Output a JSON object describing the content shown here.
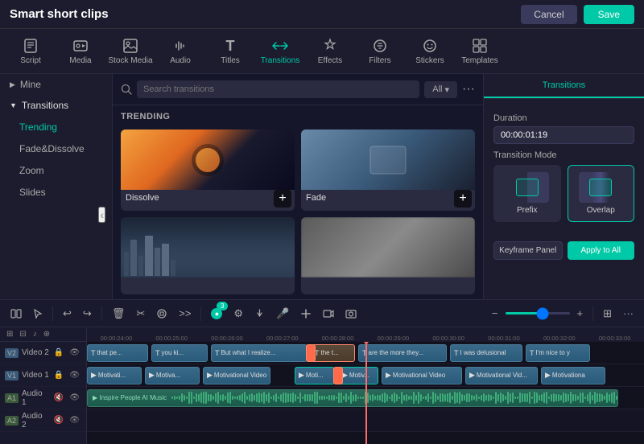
{
  "app": {
    "title": "Smart short clips",
    "cancel_label": "Cancel",
    "save_label": "Save"
  },
  "toolbar": {
    "items": [
      {
        "id": "script",
        "label": "Script",
        "icon": "📋"
      },
      {
        "id": "media",
        "label": "Media",
        "icon": "🎬"
      },
      {
        "id": "stock",
        "label": "Stock Media",
        "icon": "🖼"
      },
      {
        "id": "audio",
        "label": "Audio",
        "icon": "🎵"
      },
      {
        "id": "titles",
        "label": "Titles",
        "icon": "T"
      },
      {
        "id": "transitions",
        "label": "Transitions",
        "icon": "↔"
      },
      {
        "id": "effects",
        "label": "Effects",
        "icon": "✨"
      },
      {
        "id": "filters",
        "label": "Filters",
        "icon": "🔧"
      },
      {
        "id": "stickers",
        "label": "Stickers",
        "icon": "😊"
      },
      {
        "id": "templates",
        "label": "Templates",
        "icon": "⊞"
      }
    ]
  },
  "sidebar": {
    "mine_label": "Mine",
    "transitions_label": "Transitions",
    "items": [
      {
        "id": "trending",
        "label": "Trending",
        "active": true
      },
      {
        "id": "fade",
        "label": "Fade&Dissolve"
      },
      {
        "id": "zoom",
        "label": "Zoom"
      },
      {
        "id": "slides",
        "label": "Slides"
      }
    ]
  },
  "transitions_panel": {
    "search_placeholder": "Search transitions",
    "filter_label": "All",
    "trending_label": "TRENDING",
    "items": [
      {
        "id": "dissolve",
        "name": "Dissolve",
        "type": "dissolve"
      },
      {
        "id": "fade",
        "name": "Fade",
        "type": "fade"
      },
      {
        "id": "city",
        "name": "",
        "type": "city"
      },
      {
        "id": "blur",
        "name": "",
        "type": "blur"
      }
    ]
  },
  "right_panel": {
    "tab_label": "Transitions",
    "duration_label": "Duration",
    "duration_value": "00:00:01:19",
    "mode_label": "Transition Mode",
    "mode_prefix": "Prefix",
    "mode_overlap": "Overlap",
    "keyframe_label": "Keyframe Panel",
    "apply_all_label": "Apply to All"
  },
  "timeline": {
    "ruler_marks": [
      "00:00:24:00",
      "00:00:25:00",
      "00:00:26:00",
      "00:00:27:00",
      "00:00:28:00",
      "00:00:29:00",
      "00:00:30:00",
      "00:00:31:00",
      "00:00:32:00",
      "00:00:33:00"
    ],
    "tracks": [
      {
        "label": "Video 2",
        "type": "video",
        "clips": [
          "that pe...",
          "you ki...",
          "But what I realize is sometim...",
          "the t...",
          "are the more they try t...",
          "I was delusional",
          "I'm nice to y"
        ]
      },
      {
        "label": "Video 1",
        "type": "video",
        "clips": [
          "Motivati...",
          "Motiva...",
          "Motivational Video",
          "Moti...",
          "Motivational Video",
          "Motivational Vid...",
          "Motivationa"
        ]
      },
      {
        "label": "Audio 1",
        "type": "audio",
        "clips": [
          "Inspire People AI Music"
        ]
      },
      {
        "label": "Audio 2",
        "type": "audio",
        "clips": []
      }
    ]
  }
}
